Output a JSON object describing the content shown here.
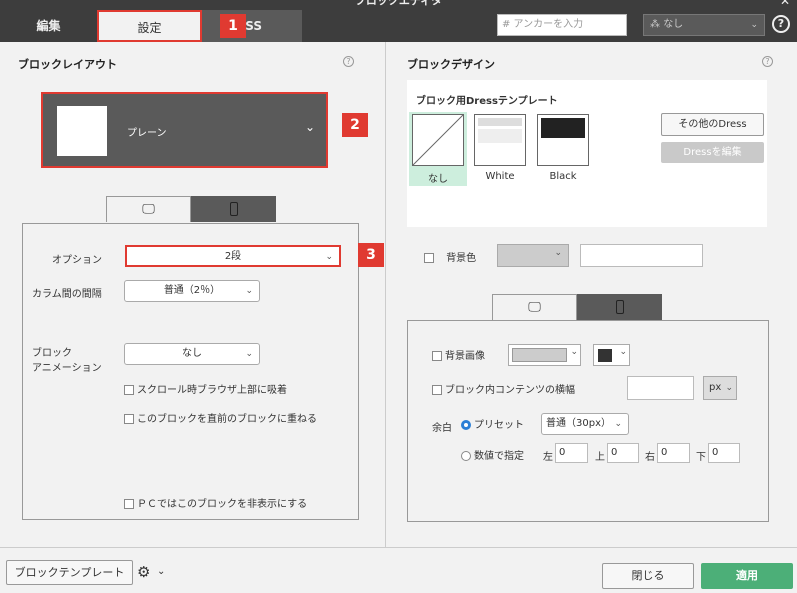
{
  "window": {
    "title": "ブロックエディタ"
  },
  "tabs": {
    "edit": "編集",
    "settings": "設定",
    "css": "SS"
  },
  "header": {
    "anchor_placeholder": "# アンカーを入力",
    "anchor_select": "なし",
    "help": "?"
  },
  "badges": [
    "1",
    "2",
    "3"
  ],
  "layout": {
    "title": "ブロックレイアウト",
    "select_label": "プレーン",
    "options": {
      "option_label": "オプション",
      "option_value": "2段",
      "gap_label": "カラム間の間隔",
      "gap_value": "普通（2％）",
      "anim_label_1": "ブロック",
      "anim_label_2": "アニメーション",
      "anim_value": "なし",
      "sticky": "スクロール時ブラウザ上部に吸着",
      "overlap": "このブロックを直前のブロックに重ねる",
      "hide_pc": "ＰＣではこのブロックを非表示にする"
    }
  },
  "design": {
    "title": "ブロックデザイン",
    "template_title": "ブロック用Dressテンプレート",
    "templates": [
      "なし",
      "White",
      "Black"
    ],
    "other_dress": "その他のDress",
    "edit_dress": "Dressを編集",
    "bg_color_label": "背景色",
    "bg_image_label": "背景画像",
    "content_width_label": "ブロック内コンテンツの横幅",
    "unit": "px",
    "margin_label": "余白",
    "preset_label": "プリセット",
    "preset_value": "普通（30px）",
    "numeric_label": "数値で指定",
    "left": "左",
    "top": "上",
    "right": "右",
    "bottom": "下",
    "left_val": "0",
    "top_val": "0",
    "right_val": "0",
    "bottom_val": "0"
  },
  "footer": {
    "template_btn": "ブロックテンプレート",
    "close": "閉じる",
    "apply": "適用"
  },
  "colors": {
    "accent_red": "#e03a31",
    "apply_green": "#4caf78",
    "selected_green": "#cdeedd"
  }
}
